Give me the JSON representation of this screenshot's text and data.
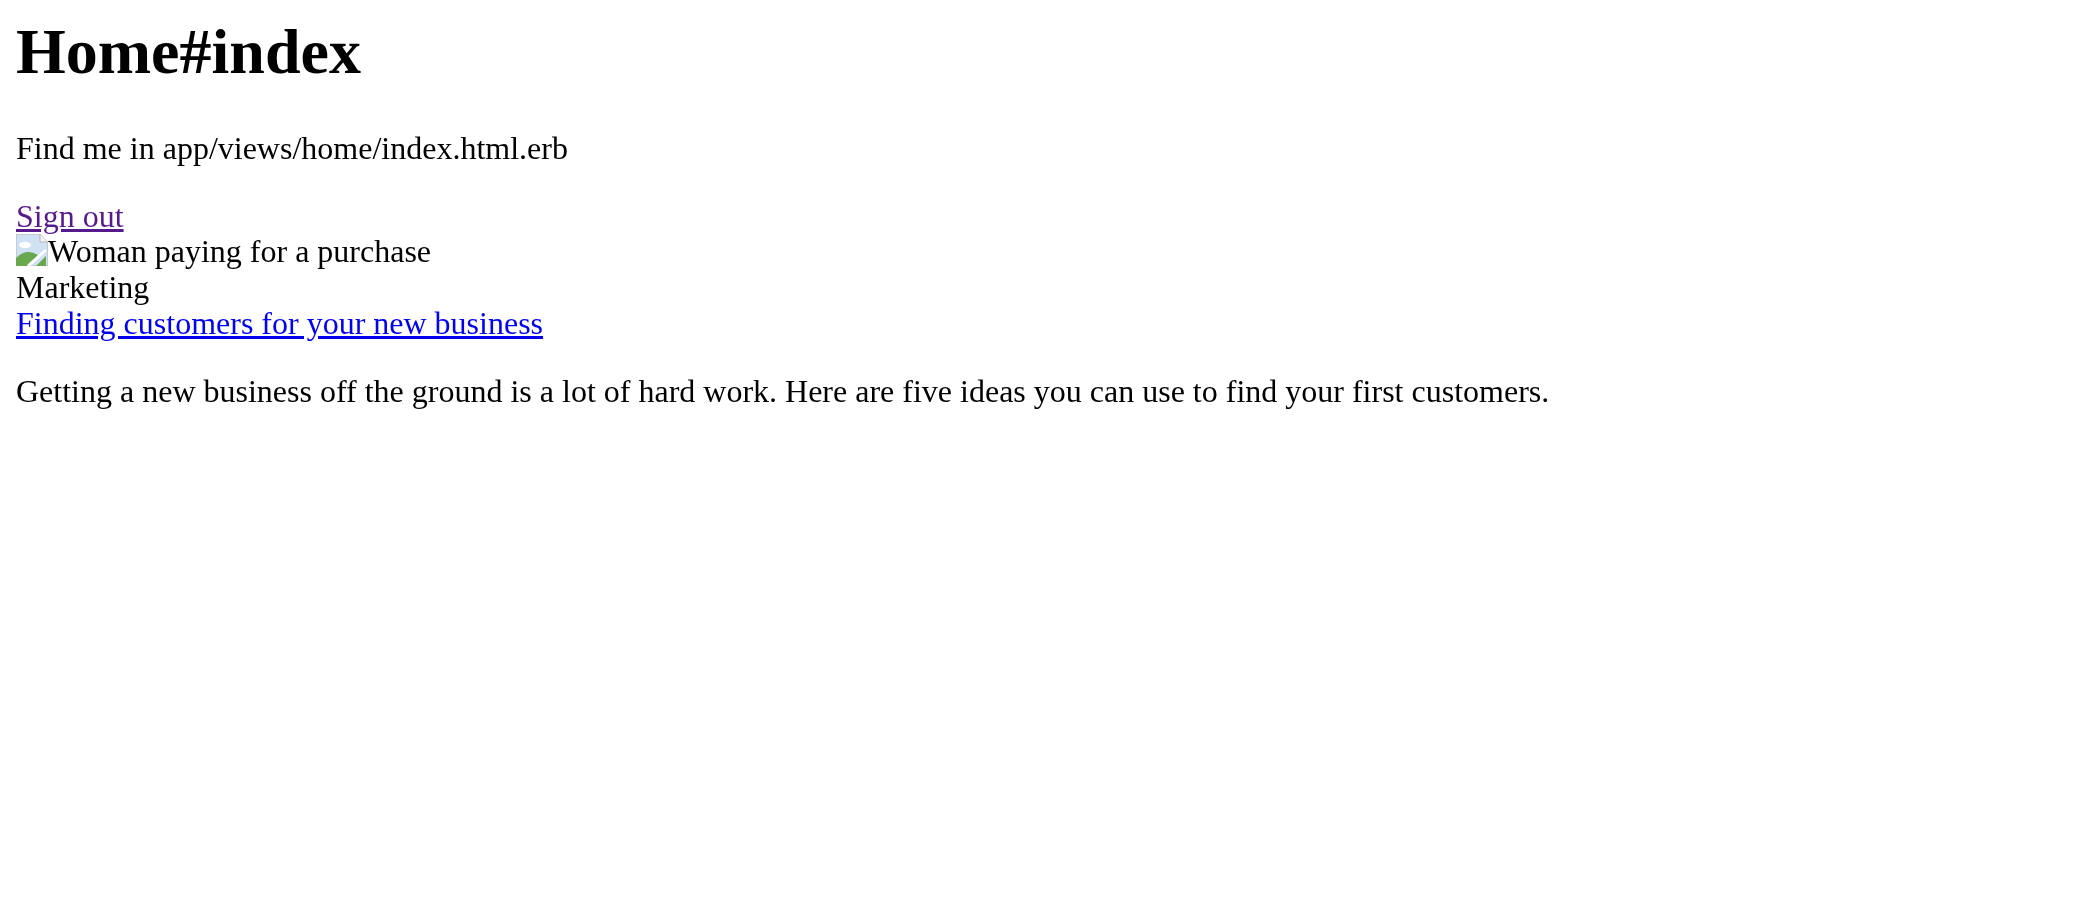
{
  "heading": "Home#index",
  "note": "Find me in app/views/home/index.html.erb",
  "sign_out_link": {
    "label": "Sign out",
    "visited": true
  },
  "article": {
    "image": {
      "alt": "Woman paying for a purchase"
    },
    "category": "Marketing",
    "title_link": {
      "label": "Finding customers for your new business",
      "visited": false
    },
    "summary": "Getting a new business off the ground is a lot of hard work. Here are five ideas you can use to find your first customers."
  }
}
